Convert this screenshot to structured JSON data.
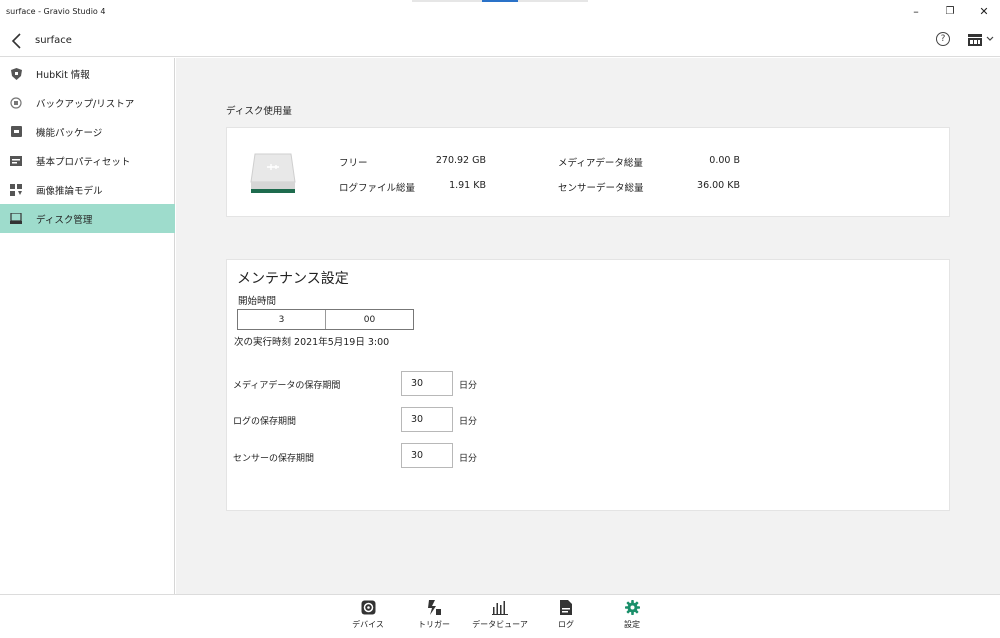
{
  "window": {
    "title": "surface - Gravio Studio 4",
    "minimize": "–",
    "maximize": "❐",
    "close": "✕"
  },
  "nav": {
    "breadcrumb": "surface",
    "help_glyph": "?"
  },
  "sidebar": {
    "items": [
      {
        "label": "HubKit 情報",
        "icon": "shield-icon"
      },
      {
        "label": "バックアップ/リストア",
        "icon": "backup-icon"
      },
      {
        "label": "機能パッケージ",
        "icon": "package-icon"
      },
      {
        "label": "基本プロパティセット",
        "icon": "property-icon"
      },
      {
        "label": "画像推論モデル",
        "icon": "model-icon"
      },
      {
        "label": "ディスク管理",
        "icon": "disk-icon",
        "active": true
      }
    ]
  },
  "disk": {
    "section_label": "ディスク使用量",
    "free_label": "フリー",
    "free_value": "270.92 GB",
    "log_label": "ログファイル総量",
    "log_value": "1.91 KB",
    "media_label": "メディアデータ総量",
    "media_value": "0.00 B",
    "sensor_label": "センサーデータ総量",
    "sensor_value": "36.00 KB"
  },
  "maintenance": {
    "heading": "メンテナンス設定",
    "start_time_label": "開始時間",
    "hour": "3",
    "minute": "00",
    "next_run": "次の実行時刻 2021年5月19日 3:00",
    "retention": [
      {
        "label": "メディアデータの保存期間",
        "value": "30",
        "unit": "日分"
      },
      {
        "label": "ログの保存期間",
        "value": "30",
        "unit": "日分"
      },
      {
        "label": "センサーの保存期間",
        "value": "30",
        "unit": "日分"
      }
    ]
  },
  "bottom_tabs": [
    {
      "label": "デバイス",
      "icon": "device-icon"
    },
    {
      "label": "トリガー",
      "icon": "trigger-icon"
    },
    {
      "label": "データビューア",
      "icon": "chart-icon"
    },
    {
      "label": "ログ",
      "icon": "log-icon"
    },
    {
      "label": "設定",
      "icon": "gear-icon",
      "active": true
    }
  ],
  "colors": {
    "accent": "#9edccc",
    "active_tab": "#1a8f6a",
    "main_bg": "#f2f2f2"
  }
}
